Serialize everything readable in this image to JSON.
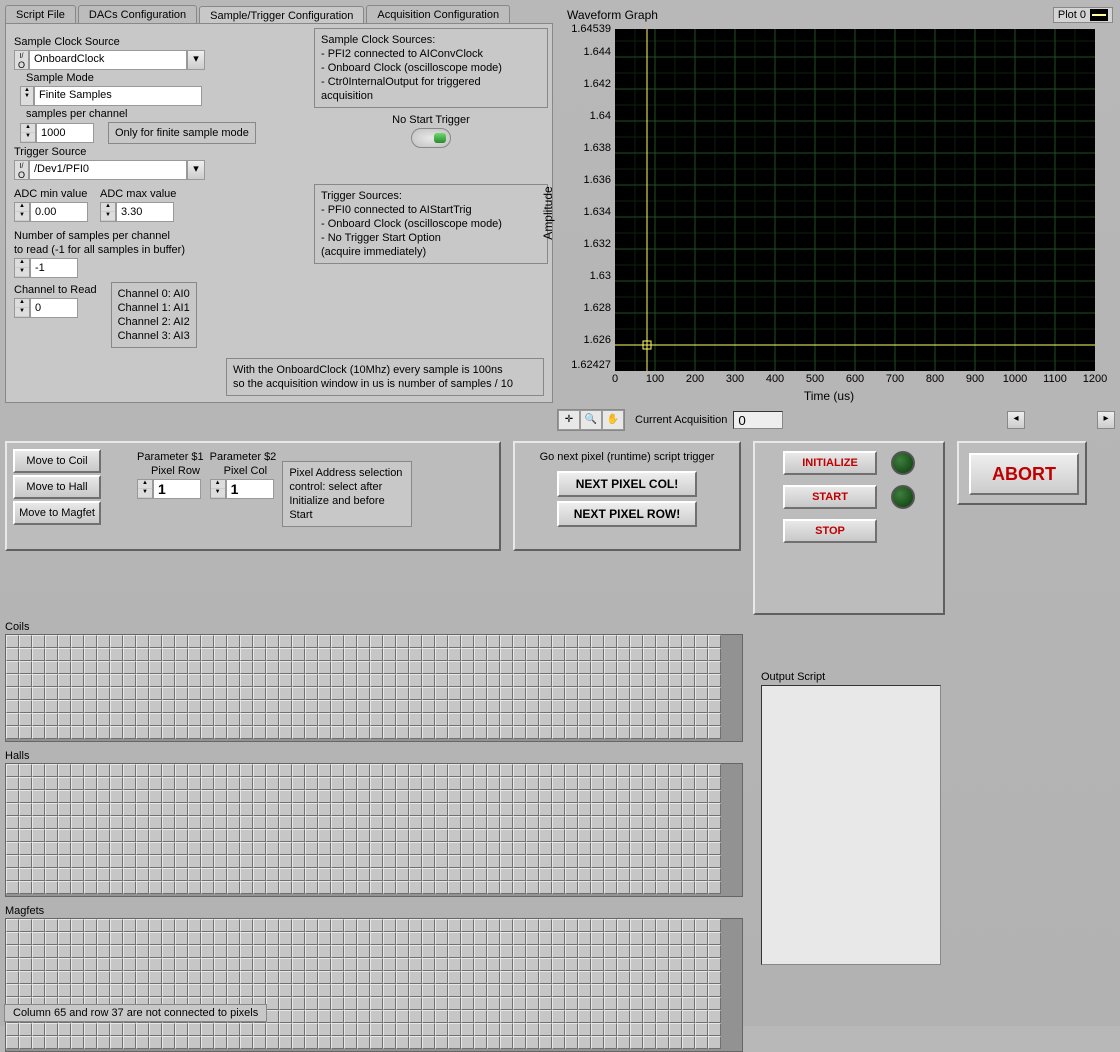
{
  "tabs": {
    "t0": "Script File",
    "t1": "DACs Configuration",
    "t2": "Sample/Trigger Configuration",
    "t3": "Acquisition Configuration"
  },
  "active_tab": 2,
  "config": {
    "sample_clock_source_label": "Sample Clock Source",
    "sample_clock_source": "OnboardClock",
    "sample_mode_label": "Sample Mode",
    "sample_mode": "Finite Samples",
    "samples_per_channel_label": "samples per channel",
    "samples_per_channel": "1000",
    "finite_note": "Only for finite sample mode",
    "trigger_source_label": "Trigger Source",
    "trigger_source": "/Dev1/PFI0",
    "adc_min_label": "ADC min value",
    "adc_min": "0.00",
    "adc_max_label": "ADC max value",
    "adc_max": "3.30",
    "num_samples_label1": "Number of samples per channel",
    "num_samples_label2": "to read (-1 for all samples in buffer)",
    "num_samples": "-1",
    "channel_read_label": "Channel to Read",
    "channel_read": "0",
    "channel_map": [
      "Channel 0: AI0",
      "Channel 1: AI1",
      "Channel 2: AI2",
      "Channel 3: AI3"
    ],
    "clk_src_title": "Sample Clock Sources:",
    "clk_src_l1": "- PFI2 connected to AIConvClock",
    "clk_src_l2": "- Onboard Clock (oscilloscope mode)",
    "clk_src_l3": "- Ctr0InternalOutput for triggered",
    "clk_src_l4": "   acquisition",
    "no_start_trigger": "No Start Trigger",
    "trg_src_title": "Trigger Sources:",
    "trg_src_l1": "- PFI0 connected to AIStartTrig",
    "trg_src_l2": "- Onboard Clock (oscilloscope mode)",
    "trg_src_l3": "- No Trigger Start Option",
    "trg_src_l4": "   (acquire immediately)",
    "clock_note_l1": "With the OnboardClock (10Mhz) every sample is 100ns",
    "clock_note_l2": "so the acquisition window in us is number of samples / 10"
  },
  "graph": {
    "title": "Waveform Graph",
    "legend": "Plot 0",
    "xlabel": "Time (us)",
    "ylabel": "Amplitude"
  },
  "chart_data": {
    "type": "line",
    "title": "Waveform Graph",
    "xlabel": "Time (us)",
    "ylabel": "Amplitude",
    "x_ticks": [
      0,
      100,
      200,
      300,
      400,
      500,
      600,
      700,
      800,
      900,
      1000,
      1100,
      1200
    ],
    "y_ticks": [
      1.62427,
      1.626,
      1.628,
      1.63,
      1.632,
      1.634,
      1.636,
      1.638,
      1.64,
      1.642,
      1.644,
      1.64539
    ],
    "xlim": [
      0,
      1200
    ],
    "ylim": [
      1.62427,
      1.64539
    ],
    "cursor": {
      "x": 80,
      "y": 1.626
    },
    "series": [
      {
        "name": "Plot 0",
        "x": [],
        "y": []
      }
    ]
  },
  "acq": {
    "current_label": "Current Acquisition",
    "current_value": "0"
  },
  "move": {
    "coil": "Move to Coil",
    "hall": "Move to Hall",
    "magfet": "Move to Magfet",
    "p1_label": "Parameter $1",
    "p1_sub": "Pixel Row",
    "p1_val": "1",
    "p2_label": "Parameter $2",
    "p2_sub": "Pixel Col",
    "p2_val": "1",
    "pixel_note_l1": "Pixel Address selection",
    "pixel_note_l2": "control: select after",
    "pixel_note_l3": "Initialize and before",
    "pixel_note_l4": "Start"
  },
  "pixel_nav": {
    "title": "Go next pixel (runtime) script trigger",
    "next_col": "NEXT PIXEL COL!",
    "next_row": "NEXT PIXEL ROW!"
  },
  "ctrl": {
    "init": "INITIALIZE",
    "start": "START",
    "stop": "STOP",
    "abort": "ABORT"
  },
  "arrays": {
    "coils": "Coils",
    "halls": "Halls",
    "magfets": "Magfets"
  },
  "output_label": "Output Script",
  "status": "Column 65 and row 37 are not connected to pixels"
}
